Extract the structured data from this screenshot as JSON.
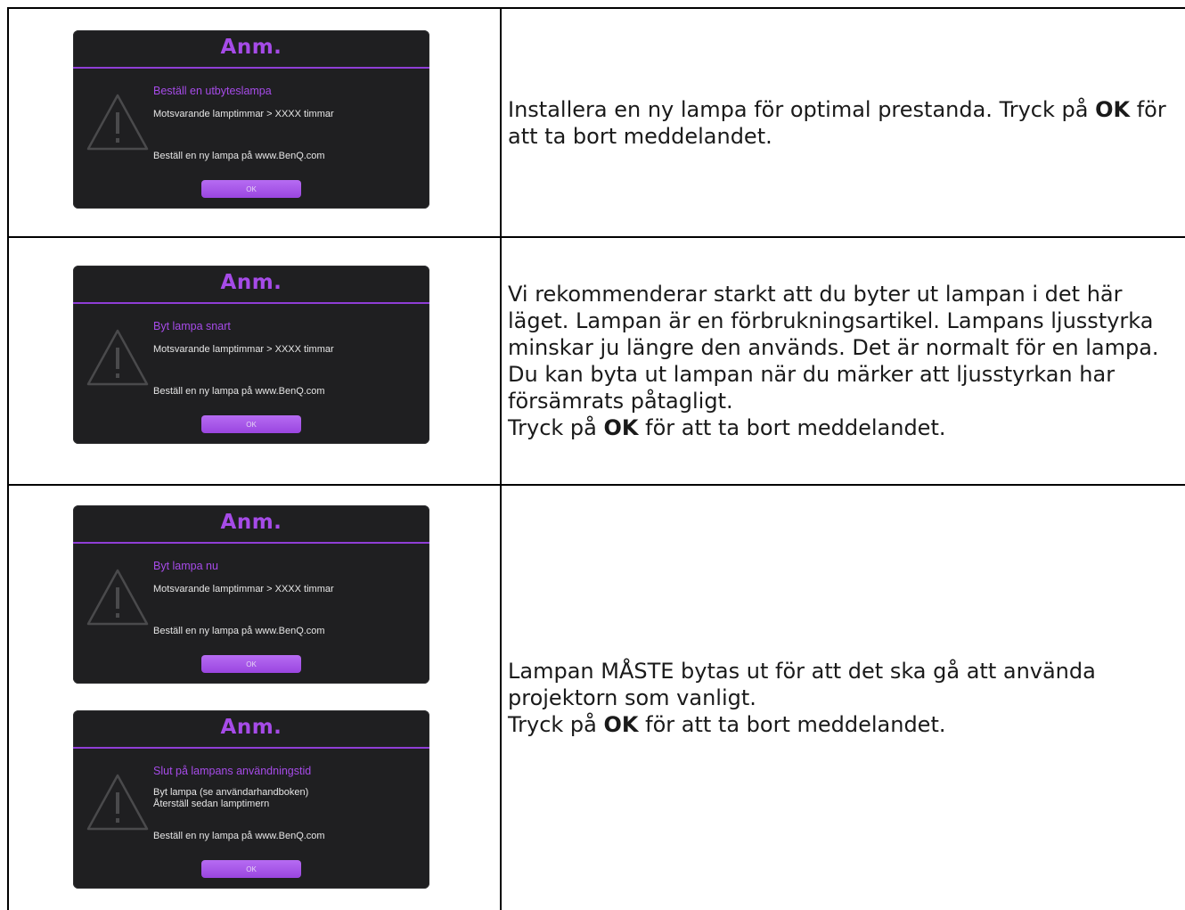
{
  "rows": [
    {
      "dialogs": [
        {
          "title": "Anm.",
          "subtitle": "Beställ en utbyteslampa",
          "lines": [
            "Motsvarande lamptimmar > XXXX timmar"
          ],
          "order": "Beställ en ny lampa på www.BenQ.com",
          "ok": "OK"
        }
      ],
      "text": {
        "part1": "Installera en ny lampa för optimal prestanda. Tryck på ",
        "bold": "OK",
        "part2": " för att ta bort meddelandet."
      }
    },
    {
      "dialogs": [
        {
          "title": "Anm.",
          "subtitle": "Byt lampa snart",
          "lines": [
            "Motsvarande lamptimmar > XXXX timmar"
          ],
          "order": "Beställ en ny lampa på www.BenQ.com",
          "ok": "OK"
        }
      ],
      "text": {
        "para1": "Vi rekommenderar starkt att du byter ut lampan i det här läget. Lampan är en förbrukningsartikel. Lampans ljusstyrka minskar ju längre den används. Det är normalt för en lampa. Du kan byta ut lampan när du märker att ljusstyrkan har försämrats påtagligt.",
        "part1": "Tryck på ",
        "bold": "OK",
        "part2": " för att ta bort meddelandet."
      }
    },
    {
      "dialogs": [
        {
          "title": "Anm.",
          "subtitle": "Byt lampa nu",
          "lines": [
            "Motsvarande lamptimmar > XXXX timmar"
          ],
          "order": "Beställ en ny lampa på www.BenQ.com",
          "ok": "OK"
        },
        {
          "title": "Anm.",
          "subtitle": "Slut på lampans användningstid",
          "lines": [
            "Byt lampa (se användarhandboken)",
            "Återställ sedan lamptimern"
          ],
          "order": "Beställ en ny lampa på www.BenQ.com",
          "ok": "OK"
        }
      ],
      "text": {
        "para1": "Lampan MÅSTE bytas ut för att det ska gå att använda projektorn som vanligt.",
        "part1": "Tryck på ",
        "bold": "OK",
        "part2": " för att ta bort meddelandet."
      }
    }
  ]
}
